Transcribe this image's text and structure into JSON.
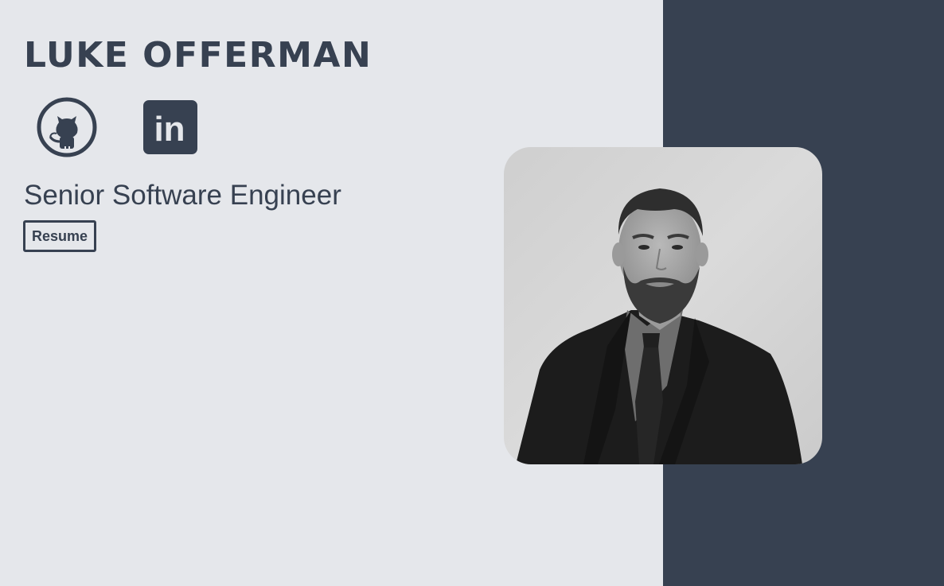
{
  "header": {
    "name": "LUKE OFFERMAN"
  },
  "social": [
    {
      "icon": "github-icon"
    },
    {
      "icon": "linkedin-icon",
      "glyph": "in"
    }
  ],
  "profile": {
    "title": "Senior Software Engineer",
    "resume_label": "Resume"
  },
  "photo": {
    "description": "headshot-portrait"
  },
  "colors": {
    "background": "#e5e7eb",
    "accent": "#374151"
  }
}
